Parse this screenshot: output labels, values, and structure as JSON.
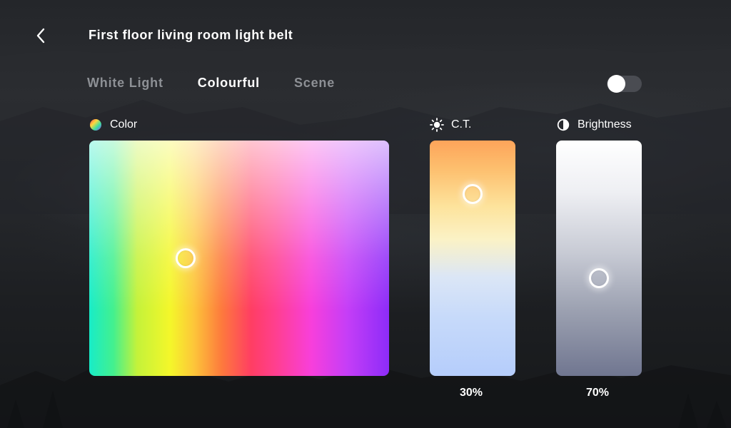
{
  "header": {
    "title": "First floor living room light belt"
  },
  "tabs": [
    {
      "label": "White Light",
      "active": false
    },
    {
      "label": "Colourful",
      "active": true
    },
    {
      "label": "Scene",
      "active": false
    }
  ],
  "power_toggle": {
    "on": false
  },
  "color": {
    "label": "Color",
    "icon": "color-wheel-icon"
  },
  "ct": {
    "label": "C.T.",
    "icon": "sun-icon",
    "value_text": "30%",
    "value": 0.3
  },
  "brightness": {
    "label": "Brightness",
    "icon": "half-circle-icon",
    "value_text": "70%",
    "value": 0.7
  },
  "colors": {
    "background": "#1f2125",
    "inactive_tab": "#8d9095",
    "toggle_track": "#4a4c52"
  }
}
